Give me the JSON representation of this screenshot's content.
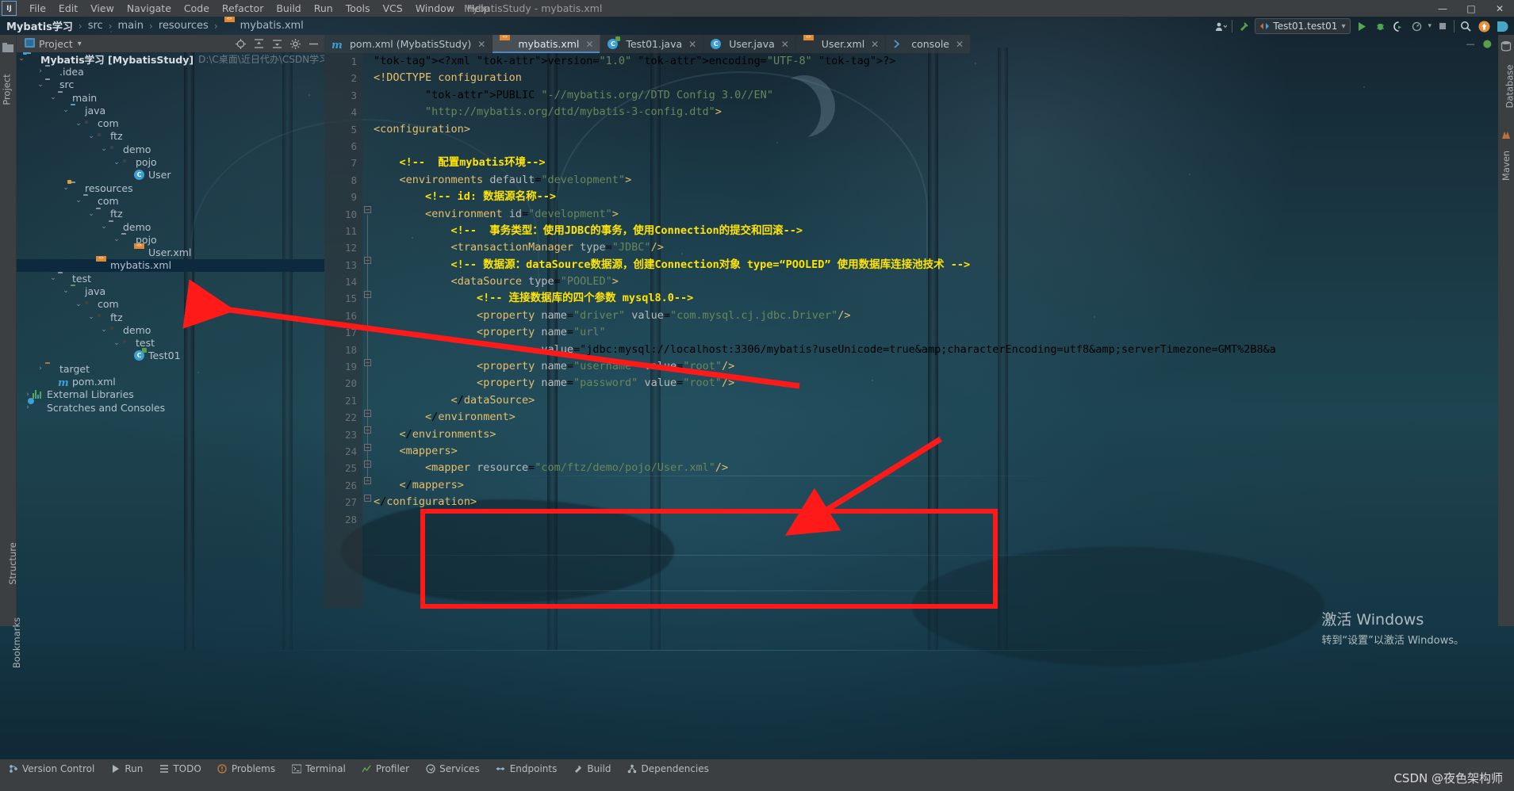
{
  "window": {
    "title": "MybatisStudy - mybatis.xml",
    "logo": "IJ",
    "minimize": "—",
    "maximize": "□",
    "close": "✕"
  },
  "menu": [
    {
      "label": "File"
    },
    {
      "label": "Edit"
    },
    {
      "label": "View"
    },
    {
      "label": "Navigate"
    },
    {
      "label": "Code"
    },
    {
      "label": "Refactor"
    },
    {
      "label": "Build"
    },
    {
      "label": "Run"
    },
    {
      "label": "Tools"
    },
    {
      "label": "VCS"
    },
    {
      "label": "Window"
    },
    {
      "label": "Help"
    }
  ],
  "breadcrumb": {
    "items": [
      "Mybatis学习",
      "src",
      "main",
      "resources",
      "mybatis.xml"
    ],
    "separator": "›"
  },
  "toolbar_right": {
    "run_config": "Test01.test01",
    "dropdown_caret": "▾",
    "search_icon": "search-icon",
    "update_icon": "update-icon",
    "ide_icon": "datagrip-icon"
  },
  "left_strip": {
    "project_label": "Project",
    "structure_label": "Structure",
    "bookmarks_label": "Bookmarks"
  },
  "right_strip": {
    "database_label": "Database",
    "maven_label": "Maven"
  },
  "project_panel": {
    "title": "Project",
    "caret": "▾",
    "icons": [
      "locate-icon",
      "collapse-all-icon",
      "expand-icon",
      "settings-gear-icon",
      "hide-icon"
    ]
  },
  "tree": [
    {
      "indent": 0,
      "twisty": "⌄",
      "icon": "project-folder",
      "label": "Mybatis学习 [MybatisStudy]",
      "bold": true,
      "sub": "D:\\C桌面\\近日代办\\CSDN学习计划\\项目训练营\\"
    },
    {
      "indent": 1,
      "twisty": "›",
      "icon": "folder",
      "label": ".idea",
      "bold": false,
      "sub": ""
    },
    {
      "indent": 1,
      "twisty": "⌄",
      "icon": "folder",
      "label": "src",
      "bold": false,
      "sub": ""
    },
    {
      "indent": 2,
      "twisty": "⌄",
      "icon": "folder",
      "label": "main",
      "bold": false,
      "sub": ""
    },
    {
      "indent": 3,
      "twisty": "⌄",
      "icon": "folder-source",
      "label": "java",
      "bold": false,
      "sub": ""
    },
    {
      "indent": 4,
      "twisty": "⌄",
      "icon": "package",
      "label": "com",
      "bold": false,
      "sub": ""
    },
    {
      "indent": 5,
      "twisty": "⌄",
      "icon": "package",
      "label": "ftz",
      "bold": false,
      "sub": ""
    },
    {
      "indent": 6,
      "twisty": "⌄",
      "icon": "package",
      "label": "demo",
      "bold": false,
      "sub": ""
    },
    {
      "indent": 7,
      "twisty": "⌄",
      "icon": "package",
      "label": "pojo",
      "bold": false,
      "sub": ""
    },
    {
      "indent": 8,
      "twisty": "",
      "icon": "java-class",
      "label": "User",
      "bold": false,
      "sub": ""
    },
    {
      "indent": 3,
      "twisty": "⌄",
      "icon": "folder-resources",
      "label": "resources",
      "bold": false,
      "sub": ""
    },
    {
      "indent": 4,
      "twisty": "⌄",
      "icon": "folder",
      "label": "com",
      "bold": false,
      "sub": ""
    },
    {
      "indent": 5,
      "twisty": "⌄",
      "icon": "folder",
      "label": "ftz",
      "bold": false,
      "sub": ""
    },
    {
      "indent": 6,
      "twisty": "⌄",
      "icon": "folder",
      "label": "demo",
      "bold": false,
      "sub": ""
    },
    {
      "indent": 7,
      "twisty": "⌄",
      "icon": "folder",
      "label": "pojo",
      "bold": false,
      "sub": ""
    },
    {
      "indent": 8,
      "twisty": "",
      "icon": "xml-file",
      "label": "User.xml",
      "bold": false,
      "sub": ""
    },
    {
      "indent": 5,
      "twisty": "",
      "icon": "xml-file",
      "label": "mybatis.xml",
      "bold": false,
      "sub": "",
      "selected": true
    },
    {
      "indent": 2,
      "twisty": "⌄",
      "icon": "folder",
      "label": "test",
      "bold": false,
      "sub": ""
    },
    {
      "indent": 3,
      "twisty": "⌄",
      "icon": "folder-test-source",
      "label": "java",
      "bold": false,
      "sub": ""
    },
    {
      "indent": 4,
      "twisty": "⌄",
      "icon": "package",
      "label": "com",
      "bold": false,
      "sub": ""
    },
    {
      "indent": 5,
      "twisty": "⌄",
      "icon": "package",
      "label": "ftz",
      "bold": false,
      "sub": ""
    },
    {
      "indent": 6,
      "twisty": "⌄",
      "icon": "package",
      "label": "demo",
      "bold": false,
      "sub": ""
    },
    {
      "indent": 7,
      "twisty": "⌄",
      "icon": "package",
      "label": "test",
      "bold": false,
      "sub": ""
    },
    {
      "indent": 8,
      "twisty": "",
      "icon": "test-class",
      "label": "Test01",
      "bold": false,
      "sub": ""
    },
    {
      "indent": 1,
      "twisty": "›",
      "icon": "folder-target",
      "label": "target",
      "bold": false,
      "sub": ""
    },
    {
      "indent": 2,
      "twisty": "",
      "icon": "maven-file",
      "label": "pom.xml",
      "bold": false,
      "sub": ""
    },
    {
      "indent": 0,
      "twisty": "›",
      "icon": "library",
      "label": "External Libraries",
      "bold": false,
      "sub": ""
    },
    {
      "indent": 0,
      "twisty": "›",
      "icon": "scratches",
      "label": "Scratches and Consoles",
      "bold": false,
      "sub": ""
    }
  ],
  "editor_tabs": [
    {
      "label": "pom.xml (MybatisStudy)",
      "icon": "maven-file-icon",
      "active": false,
      "close": "✕"
    },
    {
      "label": "mybatis.xml",
      "icon": "xml-file-icon",
      "active": true,
      "close": "✕"
    },
    {
      "label": "Test01.java",
      "icon": "test-class-icon",
      "active": false,
      "close": "✕"
    },
    {
      "label": "User.java",
      "icon": "java-class-icon",
      "active": false,
      "close": "✕"
    },
    {
      "label": "User.xml",
      "icon": "xml-file-icon",
      "active": false,
      "close": "✕"
    },
    {
      "label": "console",
      "icon": "console-icon",
      "active": false,
      "close": "✕"
    }
  ],
  "code": {
    "line_numbers": [
      1,
      2,
      3,
      4,
      5,
      6,
      7,
      8,
      9,
      10,
      11,
      12,
      13,
      14,
      15,
      16,
      17,
      18,
      19,
      20,
      21,
      22,
      23,
      24,
      25,
      26,
      27,
      28
    ],
    "lines": [
      {
        "n": 1,
        "text": "<?xml version=\"1.0\" encoding=\"UTF-8\" ?>"
      },
      {
        "n": 2,
        "text": "<!DOCTYPE configuration"
      },
      {
        "n": 3,
        "text": "        PUBLIC \"-//mybatis.org//DTD Config 3.0//EN\""
      },
      {
        "n": 4,
        "text": "        \"http://mybatis.org/dtd/mybatis-3-config.dtd\">"
      },
      {
        "n": 5,
        "text": "<configuration>"
      },
      {
        "n": 6,
        "text": ""
      },
      {
        "n": 7,
        "text": "    <!--  配置mybatis环境-->"
      },
      {
        "n": 8,
        "text": "    <environments default=\"development\">"
      },
      {
        "n": 9,
        "text": "        <!-- id: 数据源名称-->"
      },
      {
        "n": 10,
        "text": "        <environment id=\"development\">"
      },
      {
        "n": 11,
        "text": "            <!--  事务类型：使用JDBC的事务，使用Connection的提交和回滚-->"
      },
      {
        "n": 12,
        "text": "            <transactionManager type=\"JDBC\"/>"
      },
      {
        "n": 13,
        "text": "            <!-- 数据源：dataSource数据源，创建Connection对象 type=“POOLED” 使用数据库连接池技术 -->"
      },
      {
        "n": 14,
        "text": "            <dataSource type=\"POOLED\">"
      },
      {
        "n": 15,
        "text": "                <!-- 连接数据库的四个参数 mysql8.0-->"
      },
      {
        "n": 16,
        "text": "                <property name=\"driver\" value=\"com.mysql.cj.jdbc.Driver\"/>"
      },
      {
        "n": 17,
        "text": "                <property name=\"url\""
      },
      {
        "n": 18,
        "text": "                          value=\"jdbc:mysql://localhost:3306/mybatis?useUnicode=true&amp;characterEncoding=utf8&amp;serverTimezone=GMT%2B8&a"
      },
      {
        "n": 19,
        "text": "                <property name=\"username\" value=\"root\"/>"
      },
      {
        "n": 20,
        "text": "                <property name=\"password\" value=\"root\"/>"
      },
      {
        "n": 21,
        "text": "            </dataSource>"
      },
      {
        "n": 22,
        "text": "        </environment>"
      },
      {
        "n": 23,
        "text": "    </environments>"
      },
      {
        "n": 24,
        "text": "    <mappers>"
      },
      {
        "n": 25,
        "text": "        <mapper resource=\"com/ftz/demo/pojo/User.xml\"/>"
      },
      {
        "n": 26,
        "text": "    </mappers>"
      },
      {
        "n": 27,
        "text": "</configuration>"
      },
      {
        "n": 28,
        "text": ""
      }
    ]
  },
  "bottom_bar": [
    {
      "label": "Version Control",
      "icon": "branch-icon"
    },
    {
      "label": "Run",
      "icon": "play-icon"
    },
    {
      "label": "TODO",
      "icon": "todo-icon"
    },
    {
      "label": "Problems",
      "icon": "problems-icon"
    },
    {
      "label": "Terminal",
      "icon": "terminal-icon"
    },
    {
      "label": "Profiler",
      "icon": "profiler-icon"
    },
    {
      "label": "Services",
      "icon": "services-icon"
    },
    {
      "label": "Endpoints",
      "icon": "endpoints-icon"
    },
    {
      "label": "Build",
      "icon": "build-icon"
    },
    {
      "label": "Dependencies",
      "icon": "dependencies-icon"
    }
  ],
  "watermarks": {
    "activate_line1": "激活 Windows",
    "activate_line2": "转到“设置”以激活 Windows。",
    "csdn": "CSDN @夜色架构师",
    "csdn_heart": "♥"
  },
  "annotations": {
    "color": "#ff1a1a",
    "arrow1_target": "User.xml tree node",
    "arrow2_target": "mapper resource line",
    "box_target": "mappers block lines 24-26"
  },
  "colors": {
    "accent": "#4f87c4",
    "annotation_red": "#ff1a1a",
    "comment_yellow": "#ffe400",
    "tag_gold": "#e8bf6a",
    "string_green": "#6a8759",
    "panel_bg": "#3c3f41",
    "selection_blue": "#0d293e"
  }
}
